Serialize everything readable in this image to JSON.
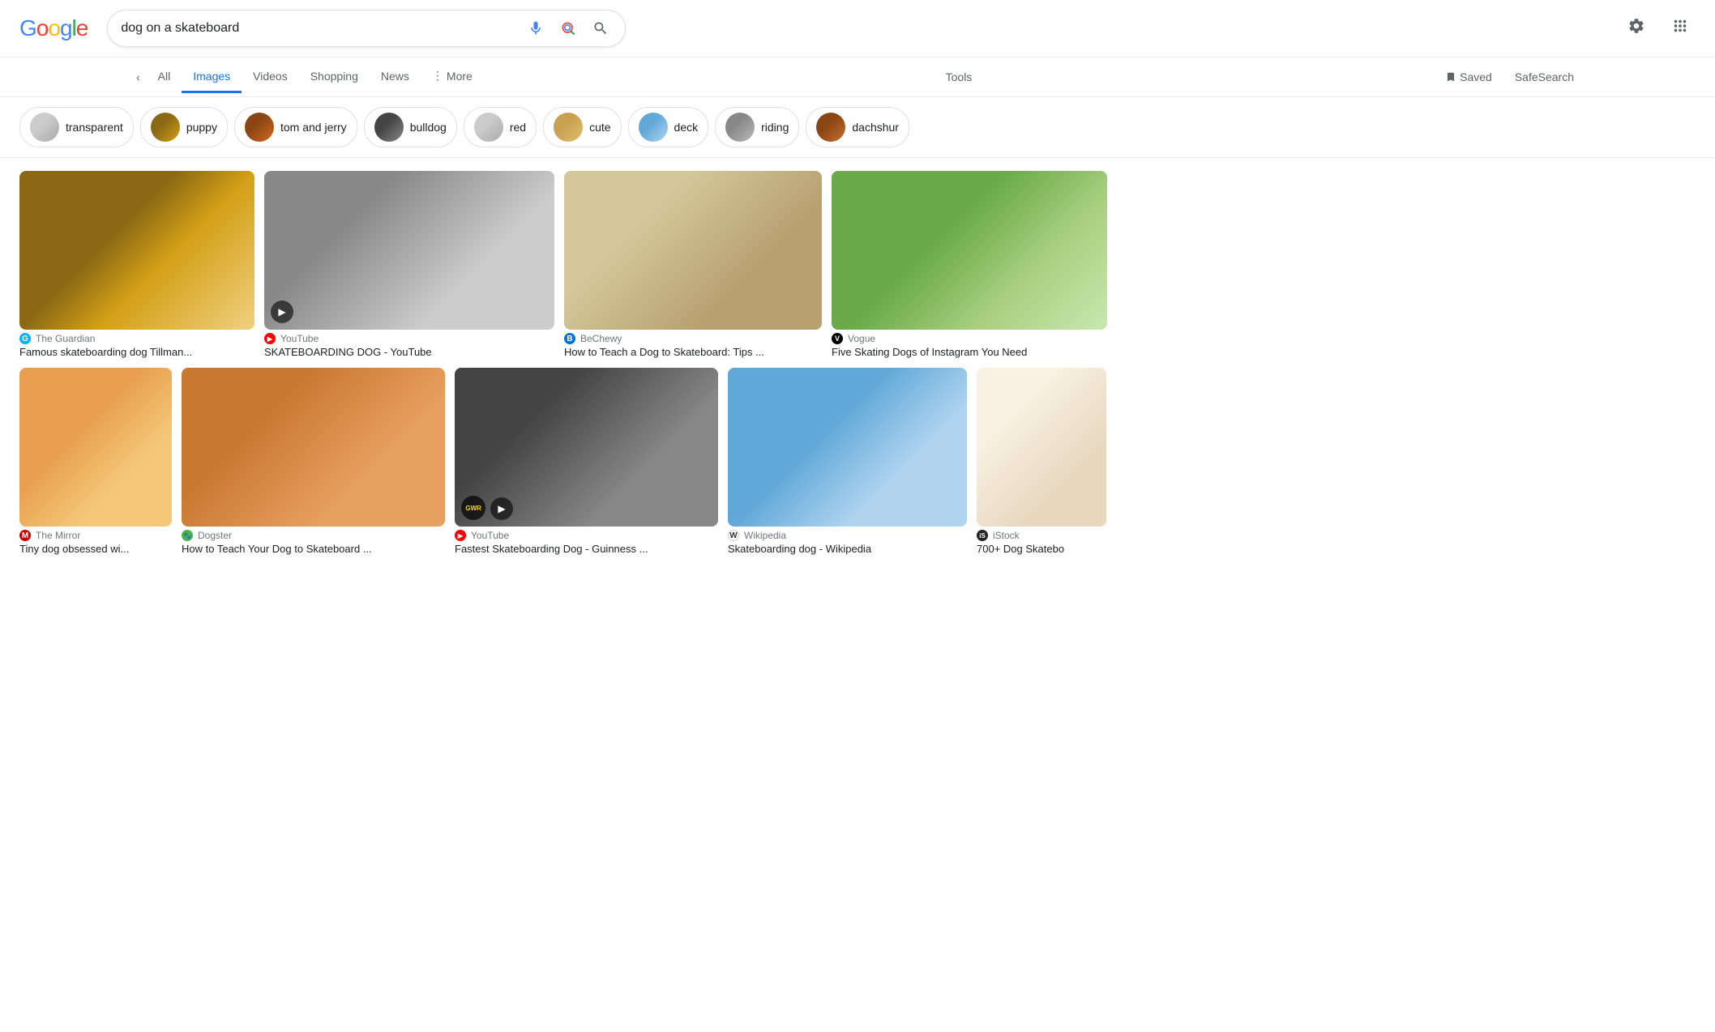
{
  "header": {
    "logo": "Google",
    "search_value": "dog on a skateboard",
    "mic_icon": "mic",
    "lens_icon": "lens",
    "search_icon": "search",
    "gear_icon": "settings",
    "grid_icon": "apps"
  },
  "nav": {
    "back_arrow": "‹",
    "items": [
      {
        "id": "all",
        "label": "All",
        "active": false
      },
      {
        "id": "images",
        "label": "Images",
        "active": true
      },
      {
        "id": "videos",
        "label": "Videos",
        "active": false
      },
      {
        "id": "shopping",
        "label": "Shopping",
        "active": false
      },
      {
        "id": "news",
        "label": "News",
        "active": false
      },
      {
        "id": "more",
        "label": "More",
        "active": false
      }
    ],
    "tools_label": "Tools",
    "saved_label": "Saved",
    "safesearch_label": "SafeSearch"
  },
  "chips": [
    {
      "id": "transparent",
      "label": "transparent",
      "thumb_class": "chip-transparent"
    },
    {
      "id": "puppy",
      "label": "puppy",
      "thumb_class": "chip-puppy"
    },
    {
      "id": "tom-and-jerry",
      "label": "tom and jerry",
      "thumb_class": "chip-tomjerry"
    },
    {
      "id": "bulldog",
      "label": "bulldog",
      "thumb_class": "chip-bulldog"
    },
    {
      "id": "red",
      "label": "red",
      "thumb_class": "chip-red"
    },
    {
      "id": "cute",
      "label": "cute",
      "thumb_class": "chip-cute"
    },
    {
      "id": "deck",
      "label": "deck",
      "thumb_class": "chip-deck"
    },
    {
      "id": "riding",
      "label": "riding",
      "thumb_class": "chip-riding"
    },
    {
      "id": "dachshund",
      "label": "dachshur",
      "thumb_class": "chip-dachshur"
    }
  ],
  "row1": [
    {
      "id": "img1",
      "bg_class": "dog1",
      "width": "300",
      "height": "200",
      "source_icon_class": "guardian",
      "source_icon_label": "G",
      "source_name": "The Guardian",
      "title": "Famous skateboarding dog Tillman...",
      "has_play": false
    },
    {
      "id": "img2",
      "bg_class": "dog2",
      "width": "360",
      "height": "200",
      "source_icon_class": "youtube",
      "source_icon_label": "▶",
      "source_name": "YouTube",
      "title": "SKATEBOARDING DOG - YouTube",
      "has_play": true
    },
    {
      "id": "img3",
      "bg_class": "dog3",
      "width": "320",
      "height": "200",
      "source_icon_class": "bechewy",
      "source_icon_label": "B",
      "source_name": "BeChewy",
      "title": "How to Teach a Dog to Skateboard: Tips ...",
      "has_play": false
    },
    {
      "id": "img4",
      "bg_class": "dog4",
      "width": "360",
      "height": "200",
      "source_icon_class": "vogue",
      "source_icon_label": "V",
      "source_name": "Vogue",
      "title": "Five Skating Dogs of Instagram You Need",
      "has_play": false
    }
  ],
  "row2": [
    {
      "id": "img5",
      "bg_class": "dog5",
      "width": "190",
      "height": "200",
      "source_icon_class": "mirror",
      "source_icon_label": "M",
      "source_name": "The Mirror",
      "title": "Tiny dog obsessed wi...",
      "has_play": false
    },
    {
      "id": "img6",
      "bg_class": "dog6",
      "width": "330",
      "height": "200",
      "source_icon_class": "dogster",
      "source_icon_label": "🐾",
      "source_name": "Dogster",
      "title": "How to Teach Your Dog to Skateboard ...",
      "has_play": false
    },
    {
      "id": "img7",
      "bg_class": "dog7",
      "width": "330",
      "height": "200",
      "source_icon_class": "youtube",
      "source_icon_label": "▶",
      "source_name": "YouTube",
      "title": "Fastest Skateboarding Dog - Guinness ...",
      "has_play": true,
      "has_guinness": true
    },
    {
      "id": "img8",
      "bg_class": "dog8",
      "width": "300",
      "height": "200",
      "source_icon_class": "wikipedia",
      "source_icon_label": "W",
      "source_name": "Wikipedia",
      "title": "Skateboarding dog - Wikipedia",
      "has_play": false
    },
    {
      "id": "img9",
      "bg_class": "dog9",
      "width": "230",
      "height": "200",
      "source_icon_class": "istock",
      "source_icon_label": "iS",
      "source_name": "iStock",
      "title": "700+ Dog Skatebo",
      "has_play": false
    }
  ]
}
